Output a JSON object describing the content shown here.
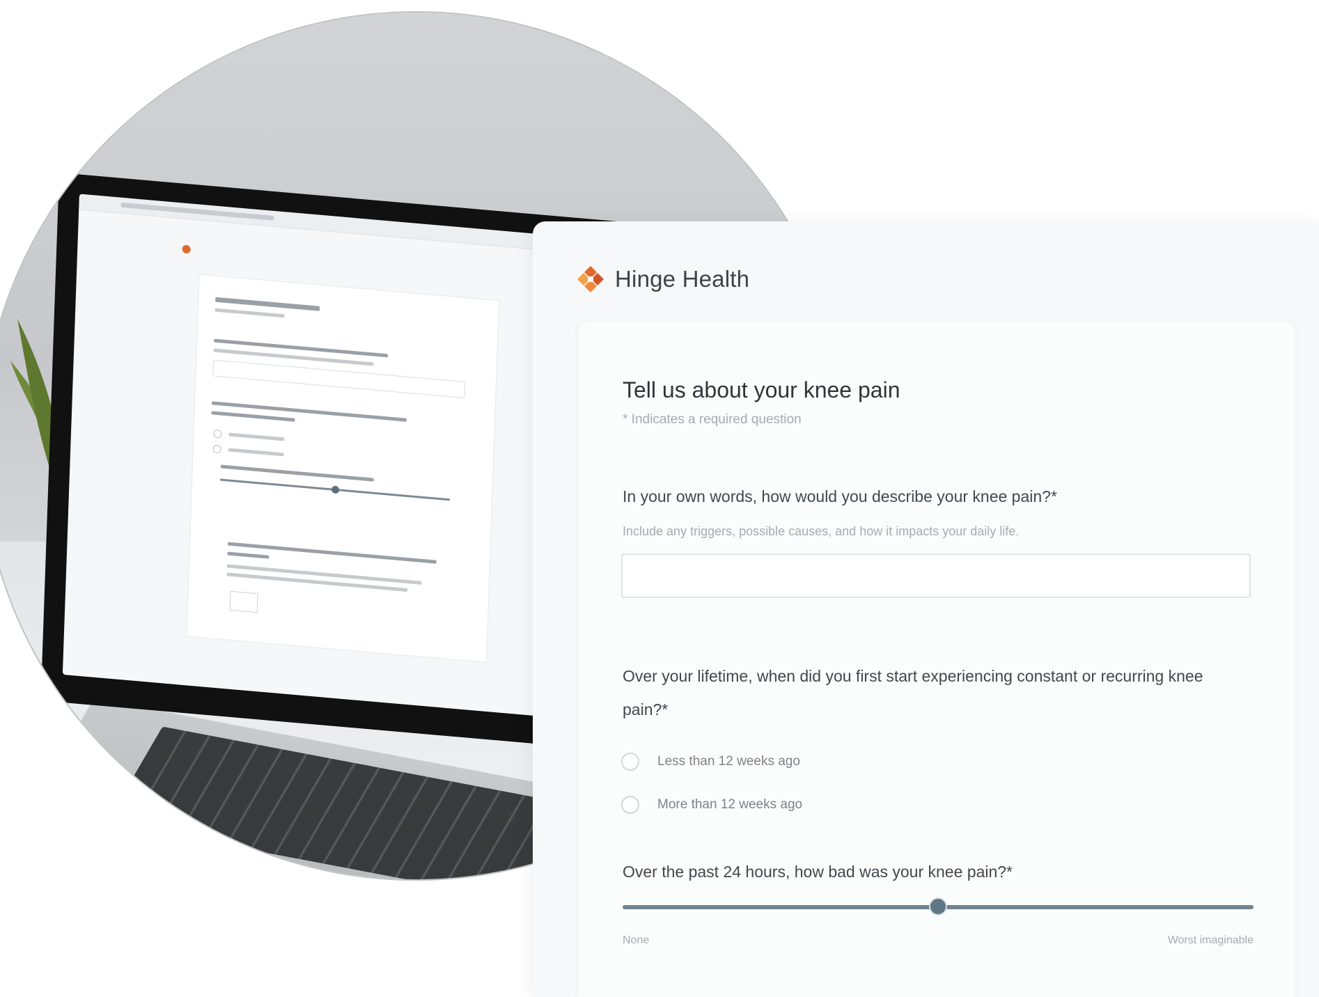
{
  "brand": {
    "name": "Hinge Health",
    "accent": "#e06a2c",
    "logo_icon": "hinge-logo-icon"
  },
  "form": {
    "title": "Tell us about your knee pain",
    "required_note": "* Indicates a required question",
    "q1": {
      "label": "In your own words, how would you describe your knee pain?*",
      "help": "Include any triggers, possible causes, and how it impacts your daily life.",
      "value": ""
    },
    "q2": {
      "label": "Over your lifetime, when did you first start experiencing constant or recurring knee pain?*",
      "options": [
        "Less than 12 weeks ago",
        "More than 12 weeks ago"
      ],
      "selected": null
    },
    "q3": {
      "label": "Over the past 24 hours, how bad was your knee pain?*",
      "min_label": "None",
      "max_label": "Worst imaginable",
      "value_fraction": 0.5
    }
  },
  "colors": {
    "panel_bg": "#f6f8f9",
    "card_bg": "#fbfcfc",
    "text_primary": "#41484d",
    "text_muted": "#a5abb0",
    "slider": "#6f8591"
  }
}
